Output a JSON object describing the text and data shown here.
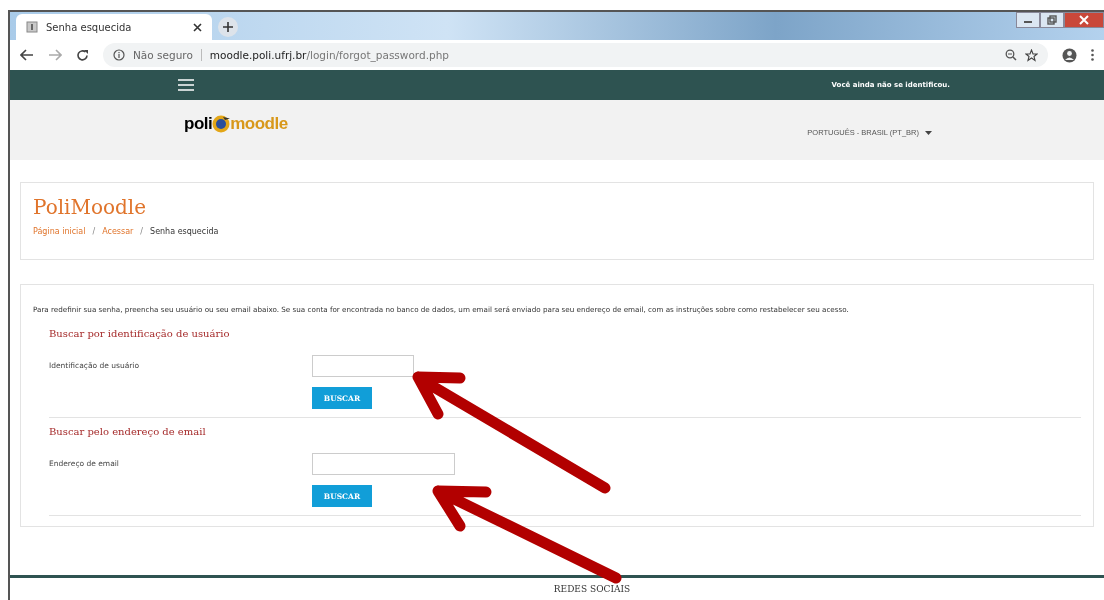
{
  "browser": {
    "tab_title": "Senha esquecida",
    "security": "Não seguro",
    "url_host": "moodle.poli.ufrj.br",
    "url_path": "/login/forgot_password.php"
  },
  "navbar": {
    "login_status": "Você ainda não se identificou."
  },
  "header": {
    "logo_left": "poli",
    "logo_right": "moodle",
    "language": "PORTUGUÊS - BRASIL (PT_BR)"
  },
  "page": {
    "title": "PoliMoodle",
    "breadcrumb": [
      {
        "label": "Página inicial",
        "link": true
      },
      {
        "separator": "/",
        "label": "Acessar",
        "link": true
      },
      {
        "separator": "/",
        "label": "Senha esquecida",
        "link": false
      }
    ]
  },
  "intro": "Para redefinir sua senha, preencha seu usuário ou seu email abaixo. Se sua conta for encontrada no banco de dados, um email será enviado para seu endereço de email, com as instruções sobre como restabelecer seu acesso.",
  "sections": [
    {
      "heading": "Buscar por identificação de usuário",
      "field_label": "Identificação de usuário",
      "button": "BUSCAR"
    },
    {
      "heading": "Buscar pelo endereço de email",
      "field_label": "Endereço de email",
      "button": "BUSCAR"
    }
  ],
  "footer": {
    "heading": "REDES SOCIAIS"
  }
}
